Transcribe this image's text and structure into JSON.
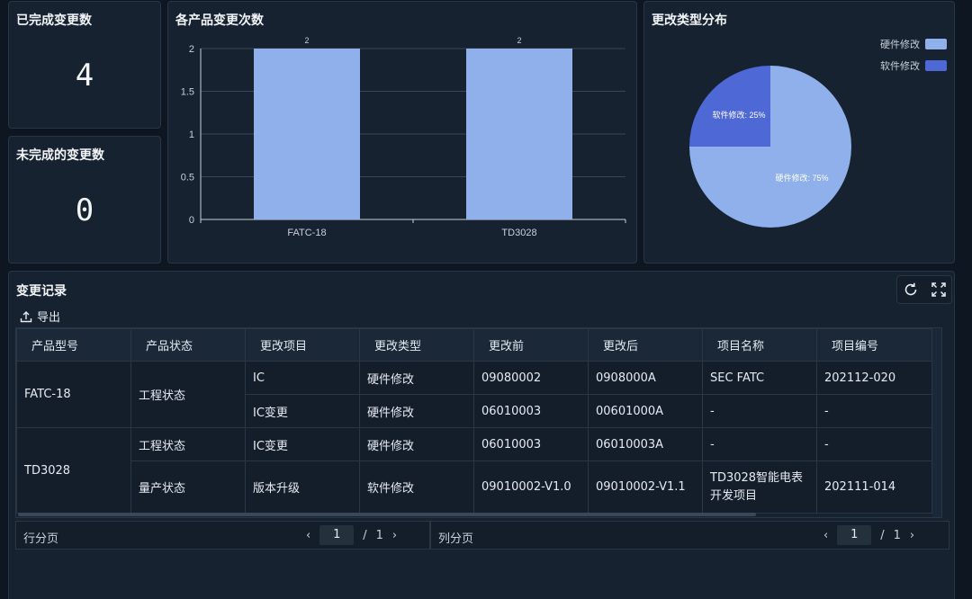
{
  "completed": {
    "title": "已完成变更数",
    "value": "4"
  },
  "incomplete": {
    "title": "未完成的变更数",
    "value": "0"
  },
  "bar_card": {
    "title": "各产品变更次数"
  },
  "pie_card": {
    "title": "更改类型分布"
  },
  "chart_data": [
    {
      "type": "bar",
      "title": "各产品变更次数",
      "categories": [
        "FATC-18",
        "TD3028"
      ],
      "values": [
        2,
        2
      ],
      "data_labels": [
        "2",
        "2"
      ],
      "ylim": [
        0,
        2
      ],
      "yticks": [
        "0",
        "0.5",
        "1",
        "1.5",
        "2"
      ],
      "grid": true,
      "color": "#8fb0ea"
    },
    {
      "type": "pie",
      "title": "更改类型分布",
      "legend_position": "top-right",
      "slices": [
        {
          "name": "硬件修改",
          "value": 75,
          "label": "硬件修改: 75%",
          "color": "#8fb0ea"
        },
        {
          "name": "软件修改",
          "value": 25,
          "label": "软件修改: 25%",
          "color": "#4e69d6"
        }
      ]
    }
  ],
  "records": {
    "title": "变更记录",
    "export_label": "导出",
    "columns": [
      "产品型号",
      "产品状态",
      "更改项目",
      "更改类型",
      "更改前",
      "更改后",
      "项目名称",
      "项目编号"
    ],
    "rows": {
      "r0": {
        "model": "FATC-18",
        "status": "工程状态",
        "item": "IC",
        "type": "硬件修改",
        "before": "09080002",
        "after": "0908000A",
        "project": "SEC FATC",
        "code": "202112-020"
      },
      "r1": {
        "item": "IC变更",
        "type": "硬件修改",
        "before": "06010003",
        "after": "00601000A",
        "project": "-",
        "code": "-"
      },
      "r2": {
        "model": "TD3028",
        "status": "工程状态",
        "item": "IC变更",
        "type": "硬件修改",
        "before": "06010003",
        "after": "06010003A",
        "project": "-",
        "code": "-"
      },
      "r3": {
        "status": "量产状态",
        "item": "版本升级",
        "type": "软件修改",
        "before": "09010002-V1.0",
        "after": "09010002-V1.1",
        "project": "TD3028智能电表开发项目",
        "code": "202111-014"
      }
    }
  },
  "pager_rows": {
    "label": "行分页",
    "current": "1",
    "separator": "/",
    "total": "1"
  },
  "pager_cols": {
    "label": "列分页",
    "current": "1",
    "separator": "/",
    "total": "1"
  }
}
